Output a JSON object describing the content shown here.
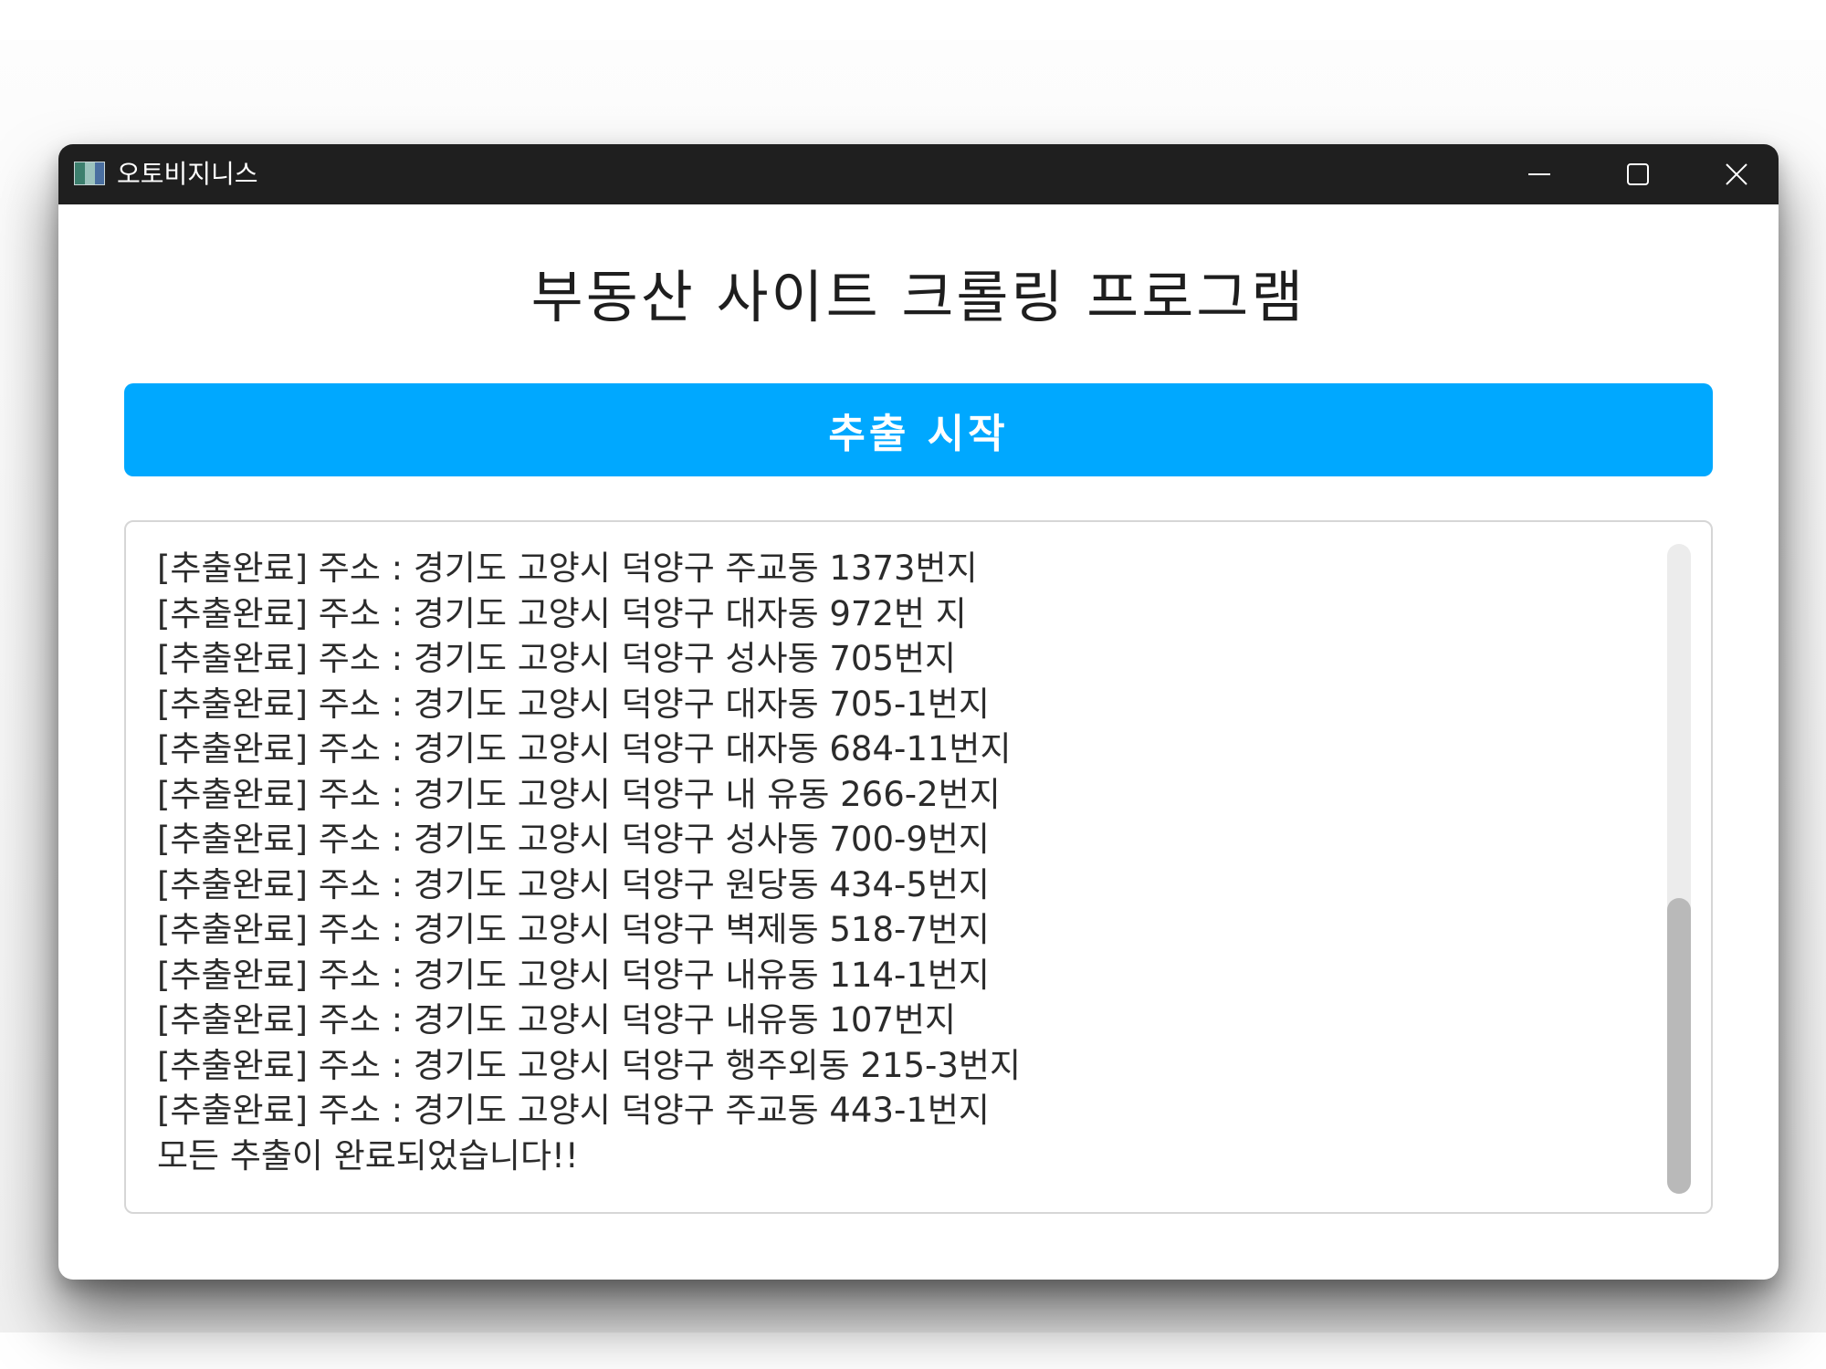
{
  "window": {
    "title": "오토비지니스",
    "icon": "app-window-icon",
    "controls": [
      "minimize-icon",
      "maximize-icon",
      "close-icon"
    ]
  },
  "main": {
    "heading": "부동산 사이트 크롤링 프로그램",
    "start_button_label": "추출 시작",
    "accent_color": "#00a8ff",
    "log": [
      "[추출완료] 주소 : 경기도 고양시 덕양구 주교동 1373번지",
      "[추출완료] 주소 : 경기도 고양시 덕양구 대자동 972번 지",
      "[추출완료] 주소 : 경기도 고양시 덕양구 성사동 705번지",
      "[추출완료] 주소 : 경기도 고양시 덕양구 대자동 705-1번지",
      "[추출완료] 주소 : 경기도 고양시 덕양구 대자동 684-11번지",
      "[추출완료] 주소 : 경기도 고양시 덕양구 내 유동 266-2번지",
      "[추출완료] 주소 : 경기도 고양시 덕양구 성사동 700-9번지",
      "[추출완료] 주소 : 경기도 고양시 덕양구 원당동 434-5번지",
      "[추출완료] 주소 : 경기도 고양시 덕양구 벽제동 518-7번지",
      "[추출완료] 주소 : 경기도 고양시 덕양구 내유동 114-1번지",
      "[추출완료] 주소 : 경기도 고양시 덕양구 내유동 107번지",
      "[추출완료] 주소 : 경기도 고양시 덕양구 행주외동 215-3번지",
      "[추출완료] 주소 : 경기도 고양시 덕양구 주교동 443-1번지",
      "모든 추출이 완료되었습니다!!"
    ]
  }
}
